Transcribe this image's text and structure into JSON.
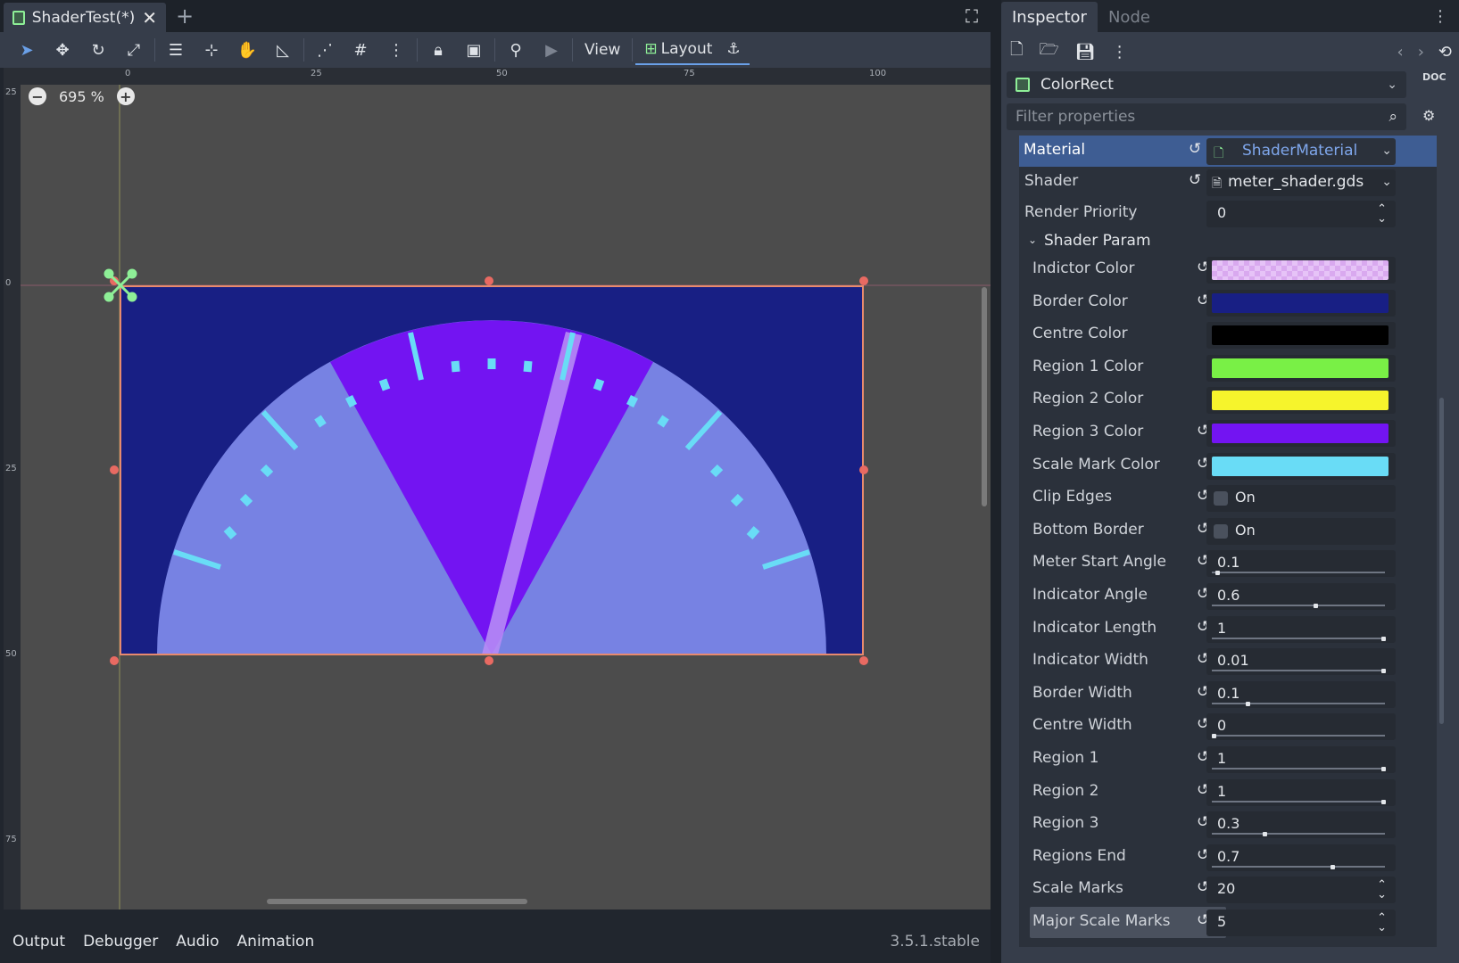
{
  "editor": {
    "tab_title": "ShaderTest(*)",
    "add_tab": "+",
    "toolbar": {
      "view_label": "View",
      "layout_label": "Layout"
    },
    "zoom_label": "695 %",
    "ruler_top": [
      "0",
      "25",
      "50",
      "75",
      "100"
    ],
    "ruler_left": [
      "25",
      "0",
      "25",
      "50",
      "75"
    ]
  },
  "bottom_panel": {
    "tabs": [
      "Output",
      "Debugger",
      "Audio",
      "Animation"
    ],
    "version": "3.5.1.stable"
  },
  "inspector": {
    "tabs": {
      "inspector": "Inspector",
      "node": "Node"
    },
    "node_name": "ColorRect",
    "doc_label": "DOC",
    "filter_placeholder": "Filter properties",
    "material": {
      "label": "Material",
      "value": "ShaderMaterial"
    },
    "shader": {
      "label": "Shader",
      "value": "meter_shader.gds"
    },
    "render_priority": {
      "label": "Render Priority",
      "value": "0"
    },
    "shader_param_header": "Shader Param",
    "colors": [
      {
        "label": "Indictor Color",
        "color": "#e6c3f7",
        "revert": true,
        "checker": true
      },
      {
        "label": "Border Color",
        "color": "#181f84",
        "revert": true
      },
      {
        "label": "Centre Color",
        "color": "#000000",
        "revert": false
      },
      {
        "label": "Region 1 Color",
        "color": "#79f046",
        "revert": false
      },
      {
        "label": "Region 2 Color",
        "color": "#f6f42c",
        "revert": false
      },
      {
        "label": "Region 3 Color",
        "color": "#7314f2",
        "revert": true
      },
      {
        "label": "Scale Mark Color",
        "color": "#69dcf6",
        "revert": true
      }
    ],
    "bools": [
      {
        "label": "Clip Edges",
        "value": "On"
      },
      {
        "label": "Bottom Border",
        "value": "On"
      }
    ],
    "sliders": [
      {
        "label": "Meter Start Angle",
        "value": "0.1",
        "fraction": 0.02
      },
      {
        "label": "Indicator Angle",
        "value": "0.6",
        "fraction": 0.6
      },
      {
        "label": "Indicator Length",
        "value": "1",
        "fraction": 1.0
      },
      {
        "label": "Indicator Width",
        "value": "0.01",
        "fraction": 1.0
      },
      {
        "label": "Border Width",
        "value": "0.1",
        "fraction": 0.2
      },
      {
        "label": "Centre Width",
        "value": "0",
        "fraction": 0.0
      },
      {
        "label": "Region 1",
        "value": "1",
        "fraction": 1.0
      },
      {
        "label": "Region 2",
        "value": "1",
        "fraction": 1.0
      },
      {
        "label": "Region 3",
        "value": "0.3",
        "fraction": 0.3
      },
      {
        "label": "Regions End",
        "value": "0.7",
        "fraction": 0.7
      }
    ],
    "spinners": [
      {
        "label": "Scale Marks",
        "value": "20"
      },
      {
        "label": "Major Scale Marks",
        "value": "5"
      }
    ]
  },
  "colors": {
    "canvas_bg": "#181f84",
    "dial_light": "#7782e3",
    "region3": "#7314f2",
    "scale_mark": "#69dcf6",
    "indicator": "#b68bf5",
    "selection": "#e88a6e"
  }
}
